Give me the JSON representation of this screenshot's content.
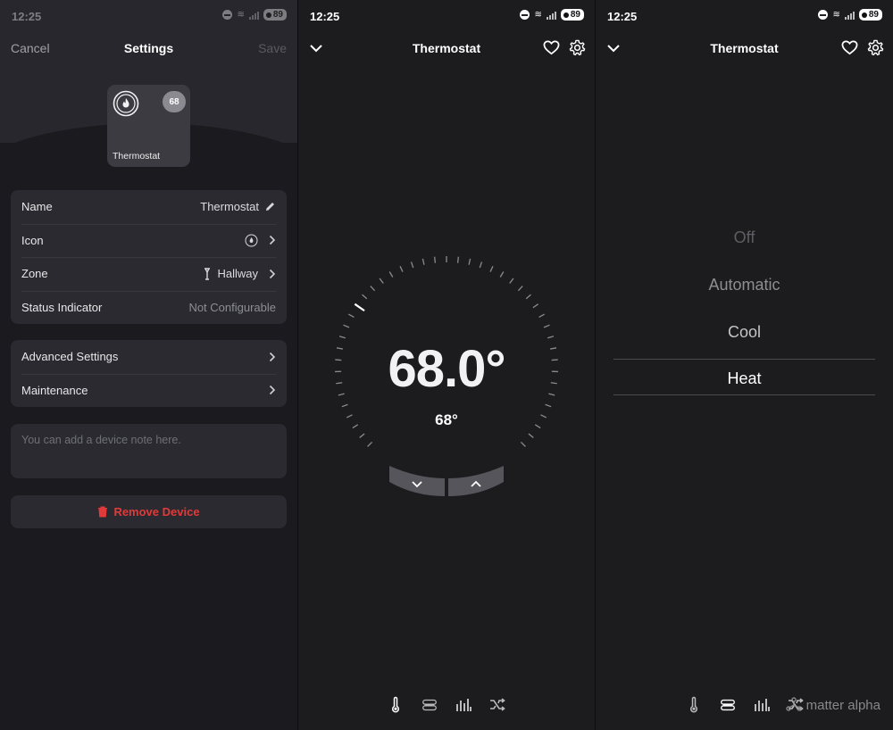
{
  "status": {
    "time": "12:25",
    "battery": "89"
  },
  "settings": {
    "cancel": "Cancel",
    "title": "Settings",
    "save": "Save",
    "tile": {
      "badge": "68",
      "label": "Thermostat"
    },
    "rows": [
      {
        "label": "Name",
        "value": "Thermostat"
      },
      {
        "label": "Icon",
        "value": ""
      },
      {
        "label": "Zone",
        "value": "Hallway"
      },
      {
        "label": "Status Indicator",
        "value": "Not Configurable"
      }
    ],
    "advanced": "Advanced Settings",
    "maintenance": "Maintenance",
    "note_placeholder": "You can add a device note here.",
    "remove": "Remove Device"
  },
  "thermostat": {
    "title": "Thermostat",
    "current_temp": "68.0°",
    "setpoint": "68°"
  },
  "modes": {
    "title": "Thermostat",
    "options": [
      "Off",
      "Automatic",
      "Cool",
      "Heat"
    ],
    "selected": "Heat"
  },
  "watermark": "matter alpha",
  "colors": {
    "accent_red": "#e23a3a",
    "panel_bg": "#1c1c1e",
    "card_bg": "#2a2a30"
  }
}
